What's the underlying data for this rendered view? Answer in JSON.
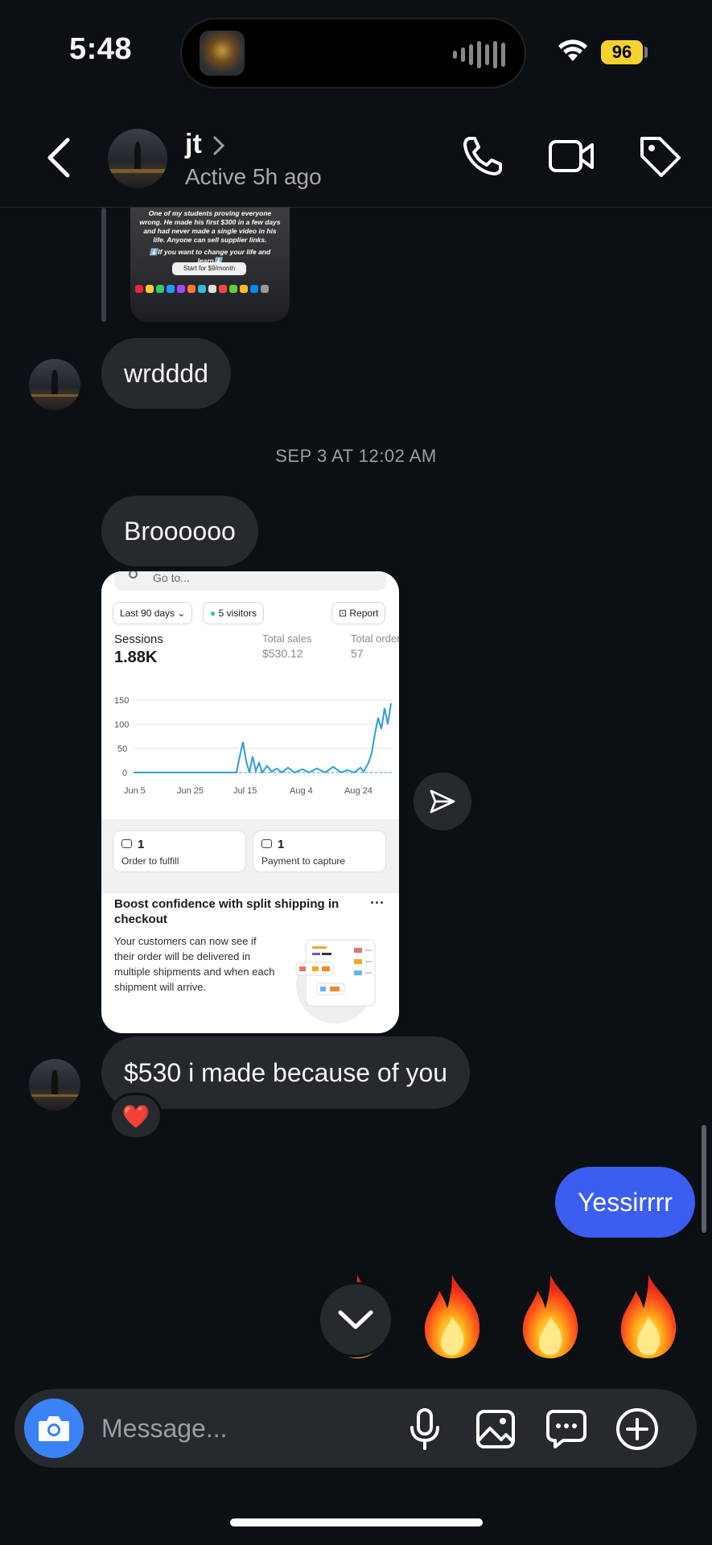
{
  "status_bar": {
    "time": "5:48",
    "battery": "96",
    "wifi_icon": "wifi-icon"
  },
  "header": {
    "name": "jt",
    "active_status": "Active 5h ago",
    "icons": [
      "back-icon",
      "phone-icon",
      "video-icon",
      "tag-icon"
    ]
  },
  "reply_preview": {
    "text": "One of my students proving everyone wrong. He made his first $300 in a few days and had never made a single video in his life. Anyone can sell supplier links.",
    "text2": "⬇️If you want to change your life and learn⬇️",
    "button": "Start for $9/month"
  },
  "messages": {
    "m1": "wrdddd",
    "timestamp": "SEP 3 AT 12:02 AM",
    "m2": "Broooooo",
    "m3": "$530 i made because of you",
    "m3_reaction": "❤️",
    "m4": "Yessirrrr"
  },
  "screenshot": {
    "search_placeholder": "Go to...",
    "range_pill": "Last 90 days",
    "visitors_pill": "5 visitors",
    "report_pill": "Report",
    "sessions_label": "Sessions",
    "sessions_value": "1.88K",
    "sales_label": "Total sales",
    "sales_value": "$530.12",
    "orders_label": "Total order",
    "orders_value": "57",
    "chart": {
      "y_ticks": [
        "150",
        "100",
        "50",
        "0"
      ],
      "x_ticks": [
        "Jun 5",
        "Jun 25",
        "Jul 15",
        "Aug 4",
        "Aug 24"
      ],
      "color": "#2e9fd6"
    },
    "task1_count": "1",
    "task1_label": "Order to fulfill",
    "task2_count": "1",
    "task2_label": "Payment to capture",
    "promo_title": "Boost confidence with split shipping in checkout",
    "promo_menu": "···",
    "promo_body": "Your customers can now see if their order will be delivered in multiple shipments and when each shipment will arrive."
  },
  "quick_reactions": [
    "🔥",
    "🔥",
    "🔥",
    "🔥"
  ],
  "composer": {
    "placeholder": "Message...",
    "icons": [
      "camera-icon",
      "microphone-icon",
      "gallery-icon",
      "sticker-icon",
      "plus-icon"
    ]
  },
  "colors": {
    "background": "#0c1014",
    "received_bubble": "#262a2f",
    "sent_bubble": "#3b5ef0",
    "camera_button": "#3b82f6",
    "battery": "#f6d22d"
  }
}
